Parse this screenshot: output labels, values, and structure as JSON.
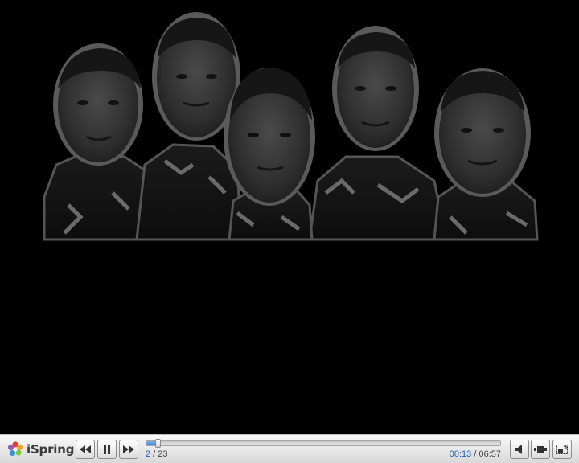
{
  "player": {
    "brand": "iSpring",
    "slide_current": "2",
    "slide_separator": " / ",
    "slide_total": "23",
    "time_current": "00:13",
    "time_separator": " / ",
    "time_total": "06:57",
    "progress_fraction": 0.031,
    "colors": {
      "accent": "#1d5fb8",
      "toolbar": "#e6e6e6"
    },
    "controls": [
      {
        "name": "previous-button",
        "icon": "rewind-icon"
      },
      {
        "name": "pause-button",
        "icon": "pause-icon"
      },
      {
        "name": "next-button",
        "icon": "fast-forward-icon"
      },
      {
        "name": "volume-button",
        "icon": "speaker-icon"
      },
      {
        "name": "outline-button",
        "icon": "outline-icon"
      },
      {
        "name": "fullscreen-button",
        "icon": "fullscreen-icon"
      }
    ]
  },
  "slide": {
    "image": "group-photo"
  }
}
